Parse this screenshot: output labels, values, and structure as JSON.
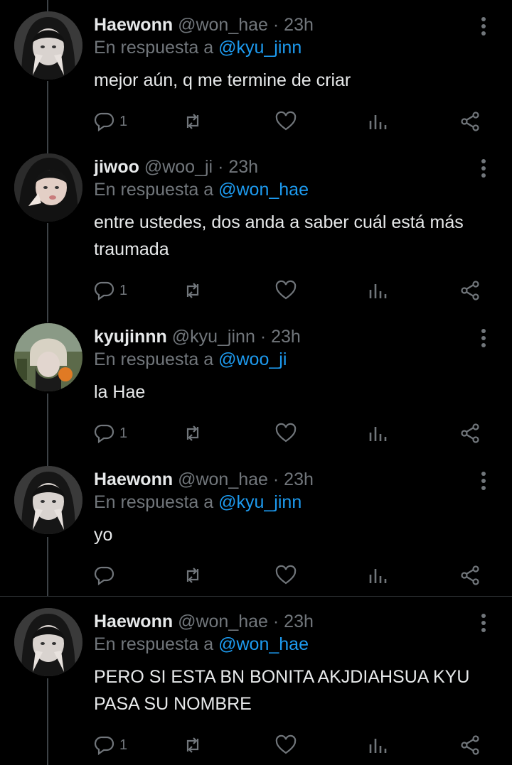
{
  "tweets": [
    {
      "name": "Haewonn",
      "handle": "@won_hae",
      "separator": "·",
      "time": "23h",
      "reply_prefix": "En respuesta a",
      "reply_to": "@kyu_jinn",
      "body": "mejor aún, q me termine de criar",
      "reply_count": "1",
      "avatar": "avatar-haewonn"
    },
    {
      "name": "jiwoo",
      "handle": "@woo_ji",
      "separator": "·",
      "time": "23h",
      "reply_prefix": "En respuesta a",
      "reply_to": "@won_hae",
      "body": "entre ustedes, dos anda a saber cuál está más traumada",
      "reply_count": "1",
      "avatar": "avatar-jiwoo"
    },
    {
      "name": "kyujinnn",
      "handle": "@kyu_jinn",
      "separator": "·",
      "time": "23h",
      "reply_prefix": "En respuesta a",
      "reply_to": "@woo_ji",
      "body": "la Hae",
      "reply_count": "1",
      "avatar": "avatar-kyujinnn"
    },
    {
      "name": "Haewonn",
      "handle": "@won_hae",
      "separator": "·",
      "time": "23h",
      "reply_prefix": "En respuesta a",
      "reply_to": "@kyu_jinn",
      "body": "yo",
      "reply_count": "",
      "avatar": "avatar-haewonn"
    },
    {
      "name": "Haewonn",
      "handle": "@won_hae",
      "separator": "·",
      "time": "23h",
      "reply_prefix": "En respuesta a",
      "reply_to": "@won_hae",
      "body": "PERO SI ESTA BN BONITA AKJDIAHSUA KYU PASA SU NOMBRE",
      "reply_count": "1",
      "avatar": "avatar-haewonn"
    }
  ],
  "icons": {
    "reply": "reply-icon",
    "retweet": "retweet-icon",
    "like": "heart-icon",
    "views": "analytics-icon",
    "share": "share-icon",
    "more": "more-options-icon"
  },
  "colors": {
    "background": "#000000",
    "text": "#e7e9ea",
    "muted": "#71767b",
    "accent": "#1d9bf0"
  }
}
